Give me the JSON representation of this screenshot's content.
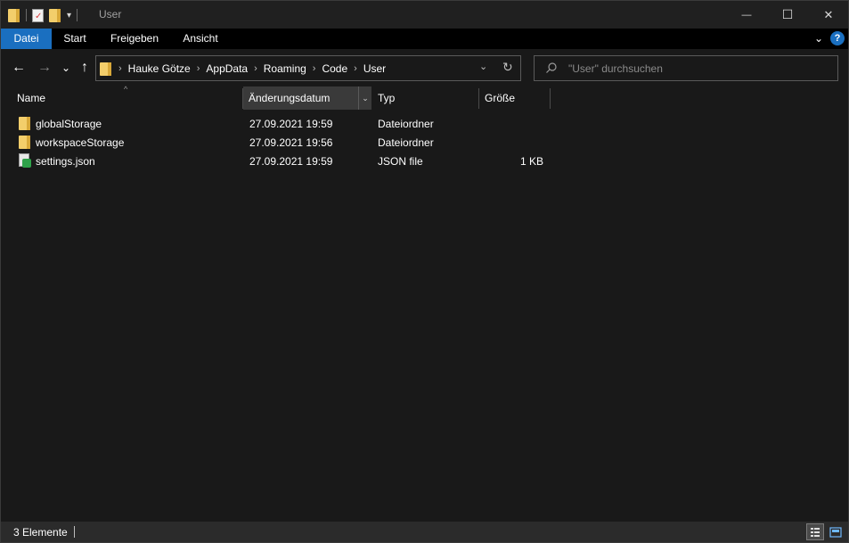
{
  "window": {
    "title": "User",
    "controls": {
      "minimize": "—",
      "maximize": "☐",
      "close": "✕"
    }
  },
  "ribbon": {
    "tabs": [
      "Datei",
      "Start",
      "Freigeben",
      "Ansicht"
    ],
    "help": "?"
  },
  "navigation": {
    "back": "←",
    "forward": "→",
    "recent": "⌄",
    "up": "↑"
  },
  "breadcrumb": [
    "Hauke Götze",
    "AppData",
    "Roaming",
    "Code",
    "User"
  ],
  "search": {
    "placeholder": "\"User\" durchsuchen"
  },
  "columns": {
    "name": "Name",
    "date": "Änderungsdatum",
    "type": "Typ",
    "size": "Größe"
  },
  "files": [
    {
      "name": "globalStorage",
      "date": "27.09.2021 19:59",
      "type": "Dateiordner",
      "size": "",
      "icon": "folder-icon"
    },
    {
      "name": "workspaceStorage",
      "date": "27.09.2021 19:56",
      "type": "Dateiordner",
      "size": "",
      "icon": "folder-icon"
    },
    {
      "name": "settings.json",
      "date": "27.09.2021 19:59",
      "type": "JSON file",
      "size": "1 KB",
      "icon": "json-file-icon"
    }
  ],
  "status": {
    "count": "3 Elemente"
  },
  "colors": {
    "accent": "#1a6fc0",
    "background": "#191919",
    "folder": "#f3ce6b"
  }
}
